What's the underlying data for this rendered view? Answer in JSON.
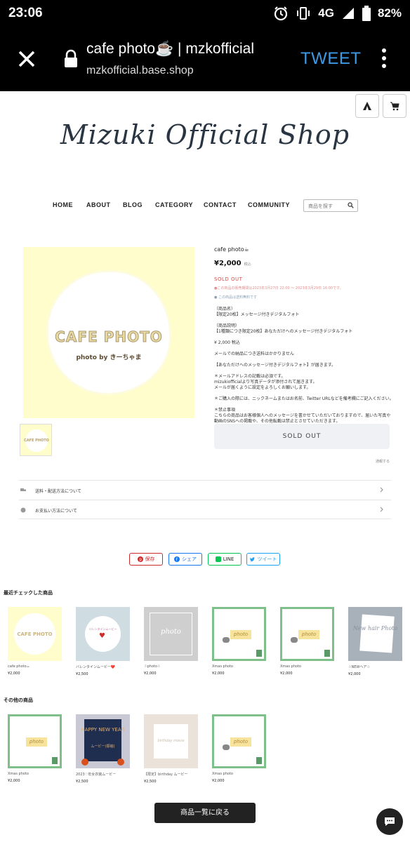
{
  "status_bar": {
    "time": "23:06",
    "network": "4G",
    "battery": "82%"
  },
  "browser": {
    "title": "cafe photo☕ | mzkofficial",
    "url": "mzkofficial.base.shop",
    "tweet_label": "TWEET"
  },
  "shop": {
    "logo_text": "Mizuki Official Shop",
    "nav": [
      "HOME",
      "ABOUT",
      "BLOG",
      "CATEGORY",
      "CONTACT",
      "COMMUNITY"
    ],
    "search_placeholder": "商品を探す"
  },
  "product": {
    "image_title": "CAFE PHOTO",
    "image_byline": "photo by きーちゃま",
    "name": "cafe photo☕",
    "price": "¥2,000",
    "tax_label": "税込",
    "status": "SOLD OUT",
    "sale_period": "●この商品の販売期間は2023年3月27日 22:00 〜 2023年3月29日 16:00です。",
    "shipping_note": "この商品は送料無料です",
    "description": "（商品名）\n【限定20枚】メッセージ付きデジタルフォト\n\n（商品説明）\n【1種類につき限定20枚】あなただけへのメッセージ付きデジタルフォト\n\n¥ 2,000 税込\n\nメールでの納品につき送料はかかりません\n\n【あなただけへのメッセージ付きデジタルフォト】が届きます。\n\n＊メールアドレスの記載は必須です。\nmizukiofficialより写真データが添付されて届きます。\nメールが届くように設定をよろしくお願いします。\n\n＊ご購入の際には、ニックネームまたはお名前、Twitter URLなどを備考欄にご記入ください。\n\n＊禁止事項\nこちらの商品はお客様個人へのメッセージを書かせていただいておりますので、届いた写真や動画のSNSへの掲載や、その他転載は禁止とさせていただきます。\nご理解の程、よろしくお願いいたします。",
    "sold_out_button": "SOLD OUT",
    "report_link": "通報する",
    "accordion": [
      "送料・配送方法について",
      "お支払い方法について"
    ]
  },
  "share": {
    "save": "保存",
    "share": "シェア",
    "line": "LINE",
    "tweet": "ツイート"
  },
  "recent": {
    "title": "最近チェックした商品",
    "items": [
      {
        "name": "cafe photo☕",
        "price": "¥2,000"
      },
      {
        "name": "バレンタインムービー❤️",
        "price": "¥2,500"
      },
      {
        "name": "☃photo☃",
        "price": "¥2,000"
      },
      {
        "name": "Xmas photo",
        "price": "¥2,000"
      },
      {
        "name": "Xmas photo",
        "price": "¥2,000"
      },
      {
        "name": "☃NEWヘア☃",
        "price": "¥2,000"
      }
    ],
    "image_texts": {
      "cafe": "CAFE PHOTO",
      "valentine": "バレンタインムービー",
      "photo": "photo",
      "newhair": "New hair Photo"
    }
  },
  "others": {
    "title": "その他の商品",
    "items": [
      {
        "name": "Xmas photo",
        "price": "¥2,000"
      },
      {
        "name": "2023♡年女衣装ムービー",
        "price": "¥2,500"
      },
      {
        "name": "【限定】birthday ムービー",
        "price": "¥2,500"
      },
      {
        "name": "Xmas photo",
        "price": "¥2,000"
      }
    ],
    "image_texts": {
      "newyear": "HAPPY NEW YEAR",
      "movie": "ムービー(振袖)",
      "birthday": "birthday movie"
    }
  },
  "back_button": "商品一覧に戻る",
  "colors": {
    "accent": "#3f9ae6",
    "soldout": "#d34c4c",
    "pinterest": "#cc2b2b",
    "facebook": "#1877f2",
    "line": "#06c755",
    "twitter": "#1da1f2"
  }
}
